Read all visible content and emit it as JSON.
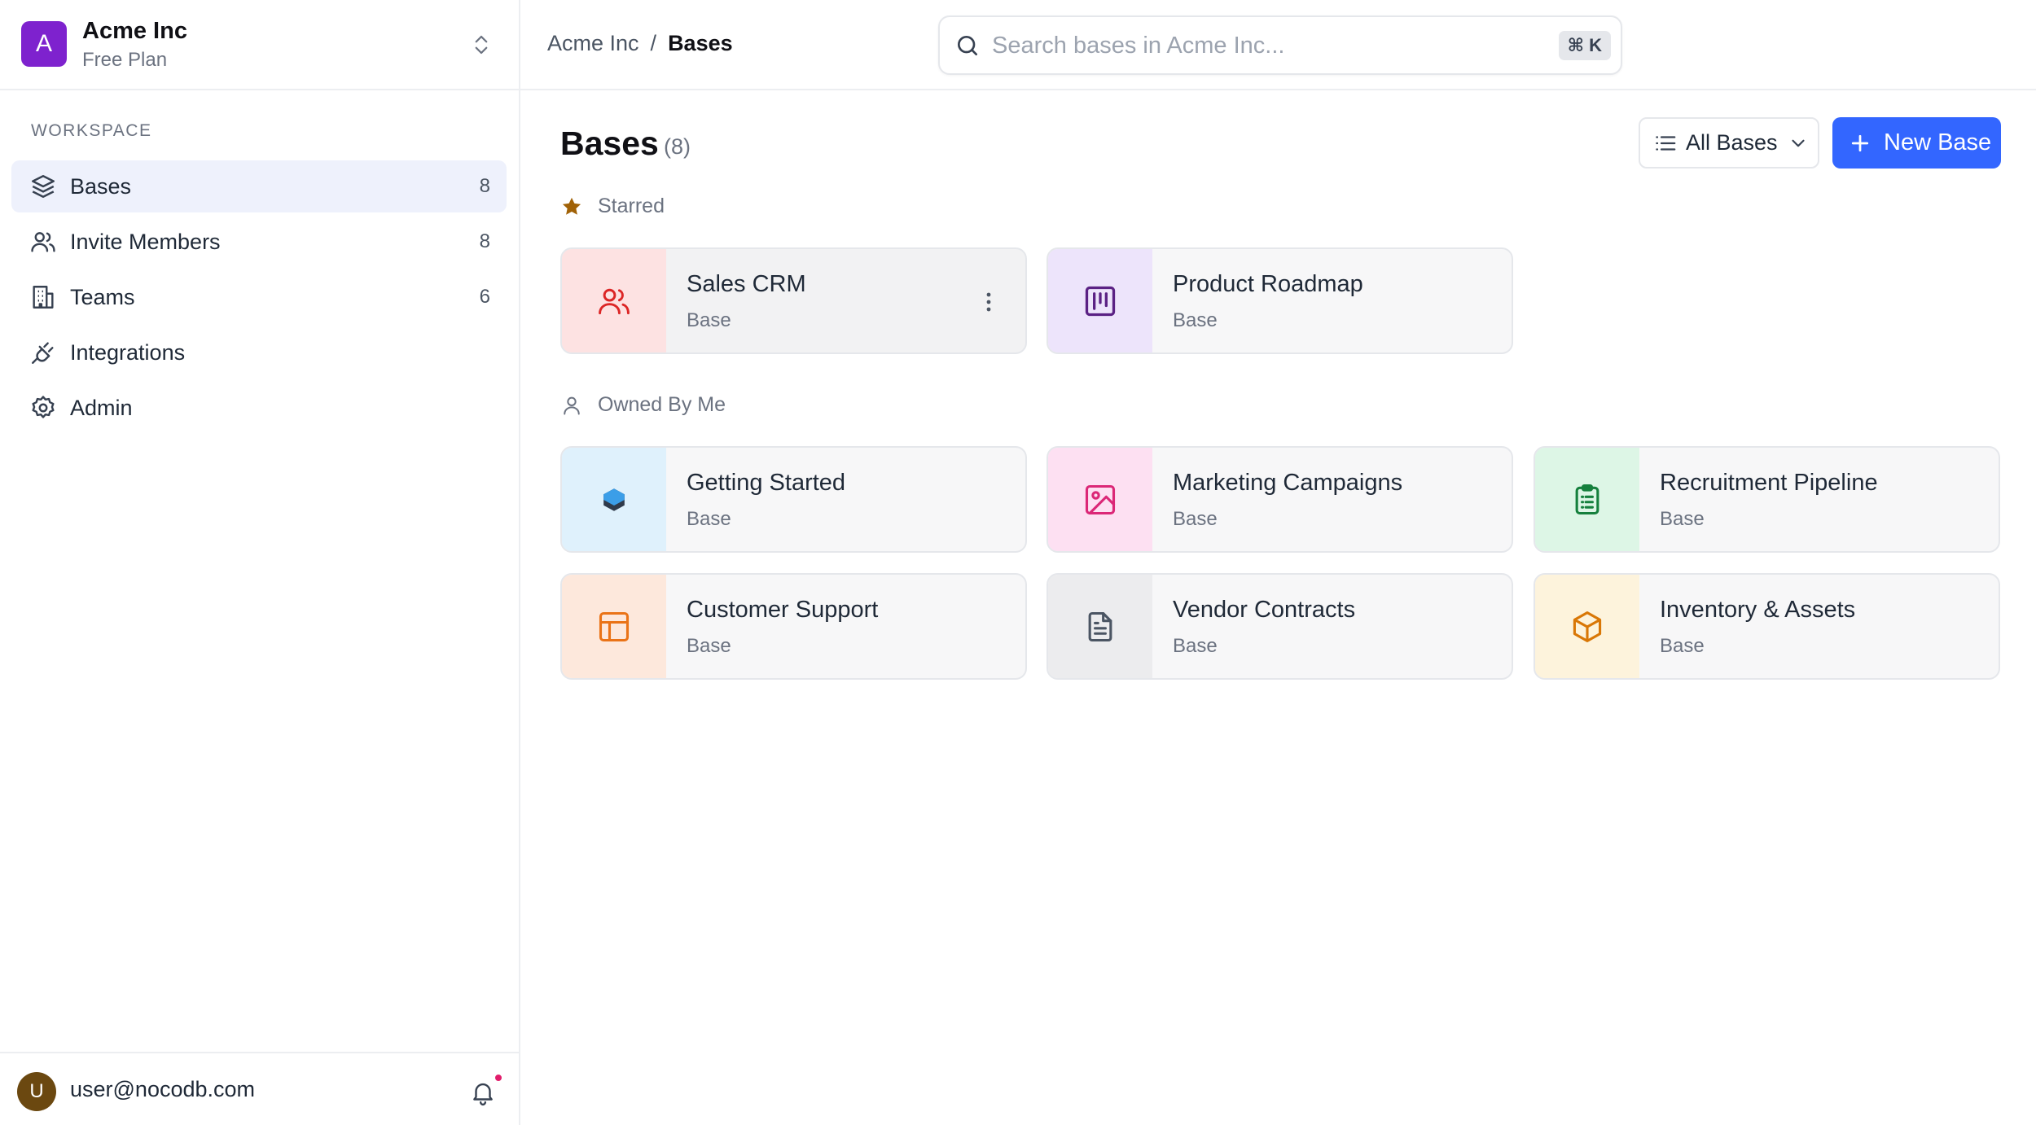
{
  "workspace": {
    "initial": "A",
    "name": "Acme Inc",
    "plan": "Free Plan",
    "avatar_color": "#7e22ce"
  },
  "sidebar": {
    "section_label": "WORKSPACE",
    "items": [
      {
        "label": "Bases",
        "count": "8",
        "icon": "layers-icon",
        "active": true
      },
      {
        "label": "Invite Members",
        "count": "8",
        "icon": "users-icon"
      },
      {
        "label": "Teams",
        "count": "6",
        "icon": "building-icon"
      },
      {
        "label": "Integrations",
        "count": "",
        "icon": "plug-icon"
      },
      {
        "label": "Admin",
        "count": "",
        "icon": "gear-icon"
      }
    ]
  },
  "user": {
    "initial": "U",
    "email": "user@nocodb.com",
    "has_notification": true
  },
  "breadcrumb": {
    "root": "Acme Inc",
    "separator": "/",
    "current": "Bases"
  },
  "search": {
    "placeholder": "Search bases in Acme Inc...",
    "shortcut": "⌘ K"
  },
  "page": {
    "title": "Bases",
    "count": "(8)",
    "filter_label": "All Bases",
    "new_button_label": "New Base"
  },
  "groups": {
    "starred": {
      "label": "Starred",
      "bases": [
        {
          "name": "Sales CRM",
          "type": "Base",
          "icon": "users-icon",
          "tile_color": "#fde2e2",
          "icon_color": "#dc2626"
        },
        {
          "name": "Product Roadmap",
          "type": "Base",
          "icon": "kanban-icon",
          "tile_color": "#ede4fb",
          "icon_color": "#5b2184"
        }
      ]
    },
    "owned": {
      "label": "Owned By Me",
      "bases": [
        {
          "name": "Getting Started",
          "type": "Base",
          "icon": "hexagon-icon",
          "tile_color": "#dff1fc",
          "icon_color": "#3b9ee8"
        },
        {
          "name": "Marketing Campaigns",
          "type": "Base",
          "icon": "image-icon",
          "tile_color": "#fde0f2",
          "icon_color": "#db2777"
        },
        {
          "name": "Recruitment Pipeline",
          "type": "Base",
          "icon": "clipboard-list-icon",
          "tile_color": "#ddf6e6",
          "icon_color": "#15803d"
        },
        {
          "name": "Customer Support",
          "type": "Base",
          "icon": "layout-icon",
          "tile_color": "#fde8dc",
          "icon_color": "#ea7317"
        },
        {
          "name": "Vendor Contracts",
          "type": "Base",
          "icon": "file-text-icon",
          "tile_color": "#ececee",
          "icon_color": "#4b5563"
        },
        {
          "name": "Inventory & Assets",
          "type": "Base",
          "icon": "box-icon",
          "tile_color": "#fdf3dc",
          "icon_color": "#d97706"
        }
      ]
    }
  },
  "colors": {
    "accent": "#3366ff",
    "active_nav_bg": "#eef1fc",
    "starred_star": "#a16207"
  }
}
